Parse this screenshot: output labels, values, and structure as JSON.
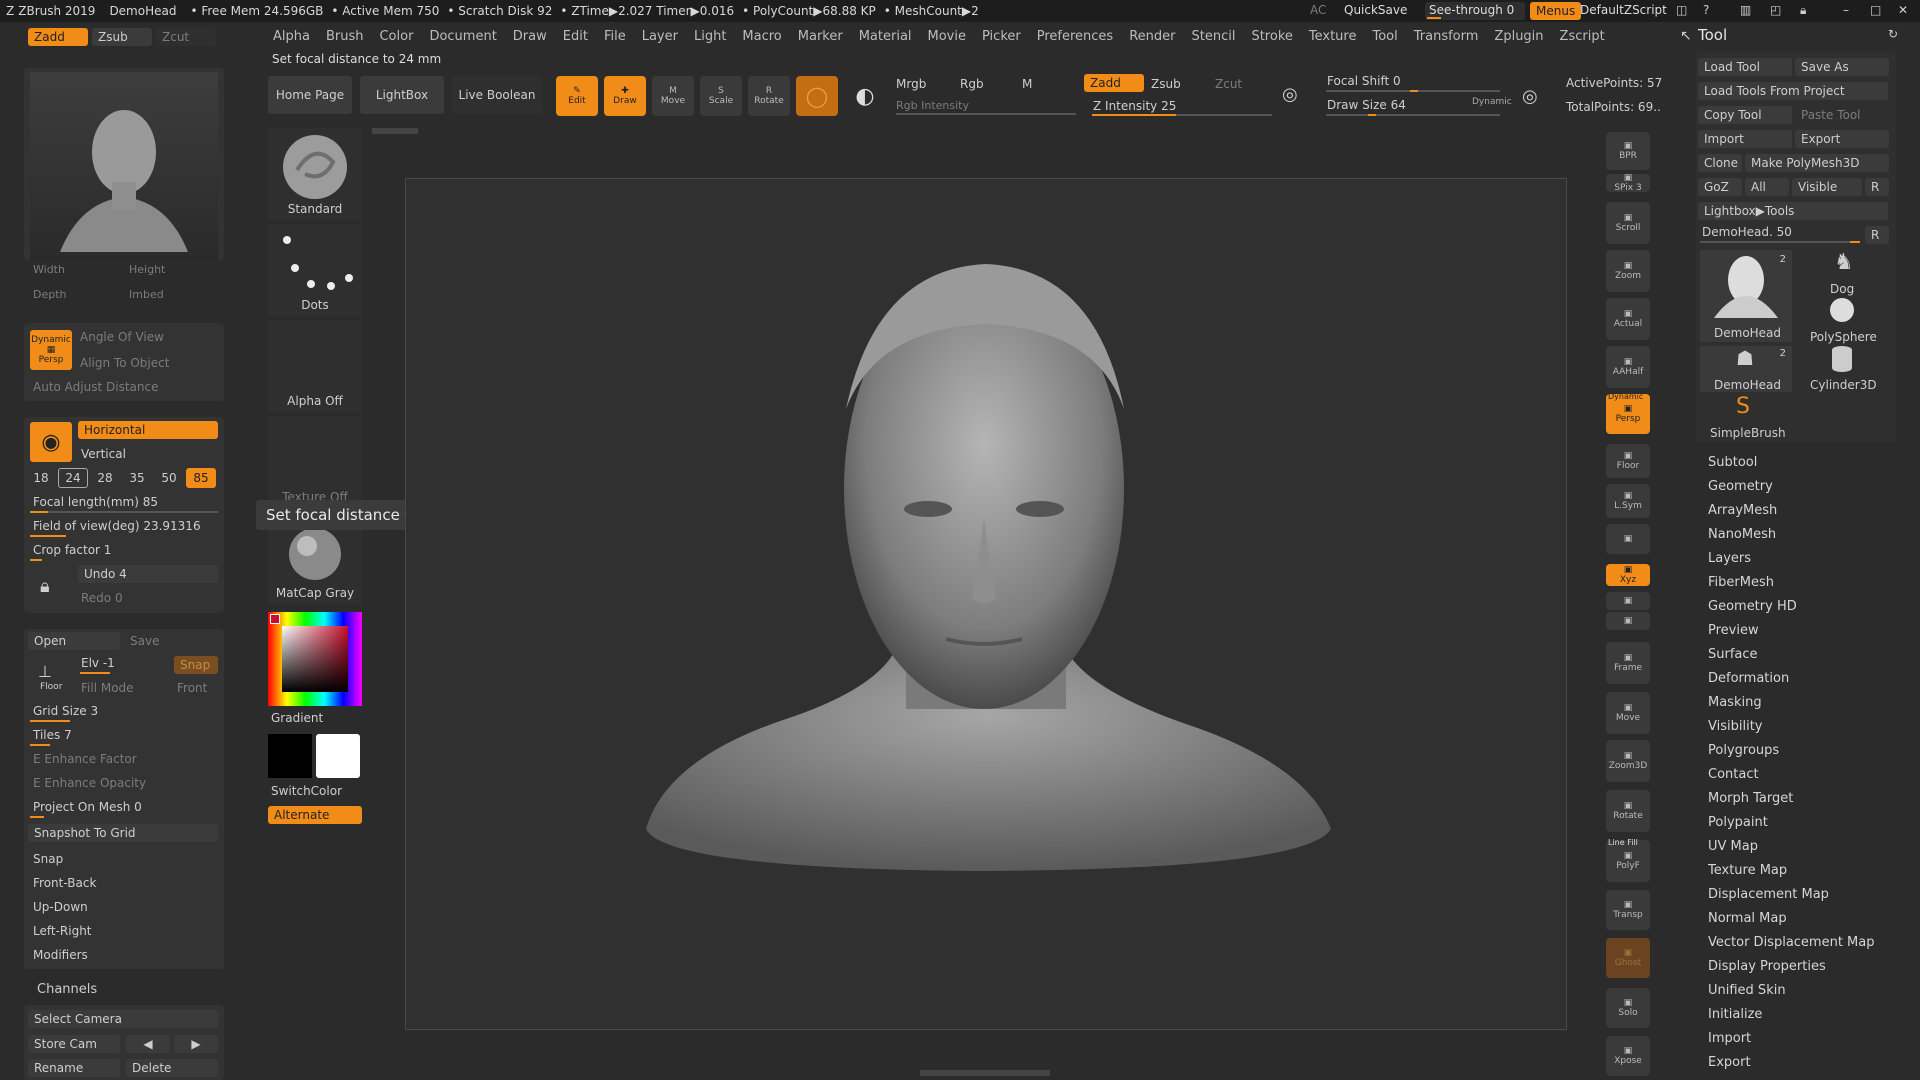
{
  "titlebar": {
    "app": "ZBrush 2019",
    "doc": "DemoHead",
    "free_mem": "• Free Mem 24.596GB",
    "active_mem": "• Active Mem 750",
    "scratch": "• Scratch Disk 92",
    "ztime": "• ZTime▶2.027 Timer▶0.016",
    "polycount": "• PolyCount▶68.88 KP",
    "meshcount": "• MeshCount▶2",
    "ac": "AC",
    "quicksave": "QuickSave",
    "seethrough": "See-through  0",
    "menus": "Menus",
    "script": "DefaultZScript"
  },
  "menus": [
    "Alpha",
    "Brush",
    "Color",
    "Document",
    "Draw",
    "Edit",
    "File",
    "Layer",
    "Light",
    "Macro",
    "Marker",
    "Material",
    "Movie",
    "Picker",
    "Preferences",
    "Render",
    "Stencil",
    "Stroke",
    "Texture",
    "Tool",
    "Transform",
    "Zplugin",
    "Zscript"
  ],
  "status_text": "Set focal distance to 24 mm",
  "left_top_modes": {
    "zadd": "Zadd",
    "zsub": "Zsub",
    "zcut": "Zcut"
  },
  "left_panel": {
    "width_label": "Width",
    "height_label": "Height",
    "depth_label": "Depth",
    "imbed_label": "Imbed",
    "persp_label": "Persp",
    "dynamic_label": "Dynamic",
    "angle_of_view": "Angle Of View",
    "align_to_object": "Align To Object",
    "auto_adjust": "Auto Adjust Distance",
    "horizontal": "Horizontal",
    "vertical": "Vertical",
    "focal_presets": [
      "18",
      "24",
      "28",
      "35",
      "50",
      "85"
    ],
    "focal_length": "Focal length(mm) 85",
    "fov": "Field of view(deg) 23.91316",
    "crop": "Crop factor 1",
    "undo": "Undo 4",
    "redo": "Redo 0",
    "open": "Open",
    "save": "Save",
    "elv": "Elv -1",
    "snap": "Snap",
    "floor": "Floor",
    "fill_mode": "Fill Mode",
    "front": "Front",
    "grid_size": "Grid Size 3",
    "tiles": "Tiles 7",
    "e_enhance_factor": "E Enhance Factor",
    "e_enhance_opacity": "E Enhance Opacity",
    "project_on_mesh": "Project On Mesh 0",
    "snapshot": "Snapshot To Grid",
    "snap2": "Snap",
    "front_back": "Front-Back",
    "up_down": "Up-Down",
    "left_right": "Left-Right",
    "modifiers": "Modifiers",
    "channels": "Channels",
    "select_camera": "Select Camera",
    "store_cam": "Store Cam",
    "rename": "Rename",
    "delete": "Delete"
  },
  "brush_column": {
    "standard": "Standard",
    "dots": "Dots",
    "alpha_off": "Alpha Off",
    "texture_off": "Texture Off",
    "matcap": "MatCap Gray",
    "gradient": "Gradient",
    "switchcolor": "SwitchColor",
    "alternate": "Alternate"
  },
  "tooltip": "Set focal distance to 24 mm",
  "shelf": {
    "home": "Home Page",
    "lightbox": "LightBox",
    "live_boolean": "Live Boolean",
    "edit": "Edit",
    "draw": "Draw",
    "move": "Move",
    "scale": "Scale",
    "rotate": "Rotate",
    "mrgb": "Mrgb",
    "rgb": "Rgb",
    "m": "M",
    "rgb_intensity": "Rgb Intensity",
    "zadd": "Zadd",
    "zsub": "Zsub",
    "zcut": "Zcut",
    "z_intensity": "Z Intensity 25",
    "focal_shift": "Focal Shift 0",
    "draw_size": "Draw Size 64",
    "dynamic": "Dynamic",
    "active_points": "ActivePoints: 57",
    "total_points": "TotalPoints: 69.."
  },
  "right_strip": [
    "BPR",
    "SPix 3",
    "Scroll",
    "Zoom",
    "Actual",
    "AAHalf",
    "Persp",
    "Floor",
    "L.Sym",
    "",
    "Xyz",
    "",
    "",
    "Frame",
    "Move",
    "Zoom3D",
    "Rotate",
    "PolyF",
    "Transp",
    "Ghost",
    "Solo",
    "Xpose"
  ],
  "right_strip_extra": {
    "dynamic": "Dynamic",
    "line_fill": "Line Fill"
  },
  "tool_panel": {
    "title": "Tool",
    "load_tool": "Load Tool",
    "save_as": "Save As",
    "load_from_project": "Load Tools From Project",
    "copy_tool": "Copy Tool",
    "paste_tool": "Paste Tool",
    "import": "Import",
    "export": "Export",
    "clone": "Clone",
    "make_polymesh": "Make PolyMesh3D",
    "goz": "GoZ",
    "all": "All",
    "visible": "Visible",
    "r": "R",
    "lightbox_tools": "Lightbox▶Tools",
    "demohead_slider": "DemoHead. 50",
    "thumbs": [
      {
        "label": "DemoHead",
        "count": "2"
      },
      {
        "label": "Dog",
        "count": ""
      },
      {
        "label": "PolySphere",
        "count": ""
      },
      {
        "label": "DemoHead",
        "count": "2"
      },
      {
        "label": "Cylinder3D",
        "count": ""
      },
      {
        "label": "SimpleBrush",
        "count": ""
      }
    ],
    "sections": [
      "Subtool",
      "Geometry",
      "ArrayMesh",
      "NanoMesh",
      "Layers",
      "FiberMesh",
      "Geometry HD",
      "Preview",
      "Surface",
      "Deformation",
      "Masking",
      "Visibility",
      "Polygroups",
      "Contact",
      "Morph Target",
      "Polypaint",
      "UV Map",
      "Texture Map",
      "Displacement Map",
      "Normal Map",
      "Vector Displacement Map",
      "Display Properties",
      "Unified Skin",
      "Initialize",
      "Import",
      "Export"
    ]
  },
  "colors": {
    "accent": "#f28c18",
    "bg": "#2b2b2b",
    "panel": "#333333"
  }
}
